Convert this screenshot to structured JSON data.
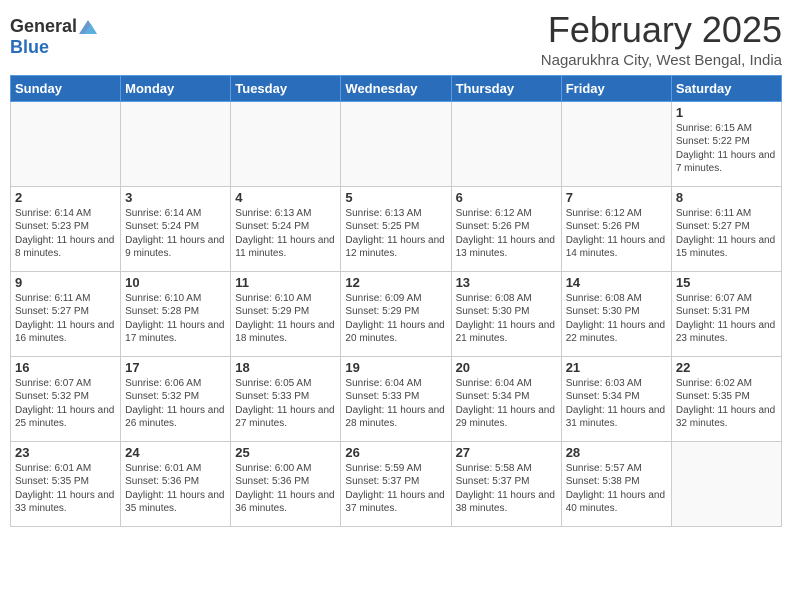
{
  "header": {
    "logo_general": "General",
    "logo_blue": "Blue",
    "month_year": "February 2025",
    "location": "Nagarukhra City, West Bengal, India"
  },
  "weekdays": [
    "Sunday",
    "Monday",
    "Tuesday",
    "Wednesday",
    "Thursday",
    "Friday",
    "Saturday"
  ],
  "weeks": [
    [
      {
        "day": "",
        "info": ""
      },
      {
        "day": "",
        "info": ""
      },
      {
        "day": "",
        "info": ""
      },
      {
        "day": "",
        "info": ""
      },
      {
        "day": "",
        "info": ""
      },
      {
        "day": "",
        "info": ""
      },
      {
        "day": "1",
        "info": "Sunrise: 6:15 AM\nSunset: 5:22 PM\nDaylight: 11 hours and 7 minutes."
      }
    ],
    [
      {
        "day": "2",
        "info": "Sunrise: 6:14 AM\nSunset: 5:23 PM\nDaylight: 11 hours and 8 minutes."
      },
      {
        "day": "3",
        "info": "Sunrise: 6:14 AM\nSunset: 5:24 PM\nDaylight: 11 hours and 9 minutes."
      },
      {
        "day": "4",
        "info": "Sunrise: 6:13 AM\nSunset: 5:24 PM\nDaylight: 11 hours and 11 minutes."
      },
      {
        "day": "5",
        "info": "Sunrise: 6:13 AM\nSunset: 5:25 PM\nDaylight: 11 hours and 12 minutes."
      },
      {
        "day": "6",
        "info": "Sunrise: 6:12 AM\nSunset: 5:26 PM\nDaylight: 11 hours and 13 minutes."
      },
      {
        "day": "7",
        "info": "Sunrise: 6:12 AM\nSunset: 5:26 PM\nDaylight: 11 hours and 14 minutes."
      },
      {
        "day": "8",
        "info": "Sunrise: 6:11 AM\nSunset: 5:27 PM\nDaylight: 11 hours and 15 minutes."
      }
    ],
    [
      {
        "day": "9",
        "info": "Sunrise: 6:11 AM\nSunset: 5:27 PM\nDaylight: 11 hours and 16 minutes."
      },
      {
        "day": "10",
        "info": "Sunrise: 6:10 AM\nSunset: 5:28 PM\nDaylight: 11 hours and 17 minutes."
      },
      {
        "day": "11",
        "info": "Sunrise: 6:10 AM\nSunset: 5:29 PM\nDaylight: 11 hours and 18 minutes."
      },
      {
        "day": "12",
        "info": "Sunrise: 6:09 AM\nSunset: 5:29 PM\nDaylight: 11 hours and 20 minutes."
      },
      {
        "day": "13",
        "info": "Sunrise: 6:08 AM\nSunset: 5:30 PM\nDaylight: 11 hours and 21 minutes."
      },
      {
        "day": "14",
        "info": "Sunrise: 6:08 AM\nSunset: 5:30 PM\nDaylight: 11 hours and 22 minutes."
      },
      {
        "day": "15",
        "info": "Sunrise: 6:07 AM\nSunset: 5:31 PM\nDaylight: 11 hours and 23 minutes."
      }
    ],
    [
      {
        "day": "16",
        "info": "Sunrise: 6:07 AM\nSunset: 5:32 PM\nDaylight: 11 hours and 25 minutes."
      },
      {
        "day": "17",
        "info": "Sunrise: 6:06 AM\nSunset: 5:32 PM\nDaylight: 11 hours and 26 minutes."
      },
      {
        "day": "18",
        "info": "Sunrise: 6:05 AM\nSunset: 5:33 PM\nDaylight: 11 hours and 27 minutes."
      },
      {
        "day": "19",
        "info": "Sunrise: 6:04 AM\nSunset: 5:33 PM\nDaylight: 11 hours and 28 minutes."
      },
      {
        "day": "20",
        "info": "Sunrise: 6:04 AM\nSunset: 5:34 PM\nDaylight: 11 hours and 29 minutes."
      },
      {
        "day": "21",
        "info": "Sunrise: 6:03 AM\nSunset: 5:34 PM\nDaylight: 11 hours and 31 minutes."
      },
      {
        "day": "22",
        "info": "Sunrise: 6:02 AM\nSunset: 5:35 PM\nDaylight: 11 hours and 32 minutes."
      }
    ],
    [
      {
        "day": "23",
        "info": "Sunrise: 6:01 AM\nSunset: 5:35 PM\nDaylight: 11 hours and 33 minutes."
      },
      {
        "day": "24",
        "info": "Sunrise: 6:01 AM\nSunset: 5:36 PM\nDaylight: 11 hours and 35 minutes."
      },
      {
        "day": "25",
        "info": "Sunrise: 6:00 AM\nSunset: 5:36 PM\nDaylight: 11 hours and 36 minutes."
      },
      {
        "day": "26",
        "info": "Sunrise: 5:59 AM\nSunset: 5:37 PM\nDaylight: 11 hours and 37 minutes."
      },
      {
        "day": "27",
        "info": "Sunrise: 5:58 AM\nSunset: 5:37 PM\nDaylight: 11 hours and 38 minutes."
      },
      {
        "day": "28",
        "info": "Sunrise: 5:57 AM\nSunset: 5:38 PM\nDaylight: 11 hours and 40 minutes."
      },
      {
        "day": "",
        "info": ""
      }
    ]
  ]
}
